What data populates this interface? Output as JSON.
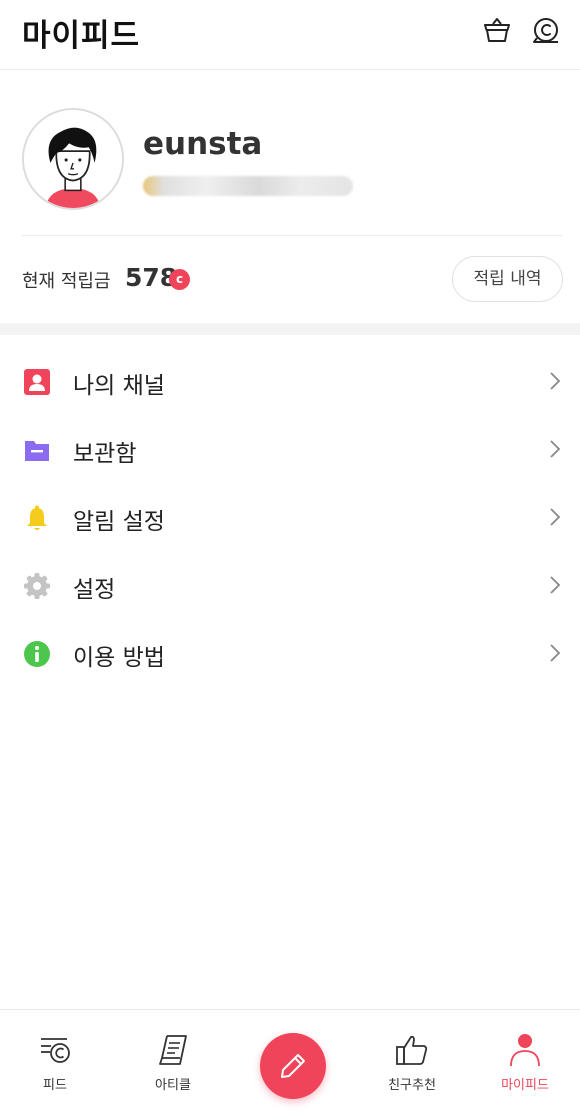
{
  "header": {
    "title": "마이피드",
    "icons": [
      "basket-icon",
      "coin-icon"
    ]
  },
  "profile": {
    "username": "eunsta",
    "avatar": "avatar-illustration"
  },
  "points": {
    "label": "현재 적립금",
    "value": "578",
    "coin_symbol": "c",
    "history_button": "적립 내역"
  },
  "menu": {
    "items": [
      {
        "label": "나의 채널",
        "icon": "person-icon",
        "color": "#f0445a"
      },
      {
        "label": "보관함",
        "icon": "folder-icon",
        "color": "#8b6cf0"
      },
      {
        "label": "알림 설정",
        "icon": "bell-icon",
        "color": "#f5cc1b"
      },
      {
        "label": "설정",
        "icon": "gear-icon",
        "color": "#c4c4c4"
      },
      {
        "label": "이용 방법",
        "icon": "info-icon",
        "color": "#4cc64c"
      }
    ]
  },
  "bottom_nav": {
    "items": [
      {
        "label": "피드",
        "icon": "feed-icon",
        "active": false
      },
      {
        "label": "아티클",
        "icon": "article-icon",
        "active": false
      },
      {
        "label": "친구추천",
        "icon": "thumbs-up-icon",
        "active": false
      },
      {
        "label": "마이피드",
        "icon": "profile-icon",
        "active": true
      }
    ],
    "compose_icon": "pencil-icon"
  },
  "colors": {
    "accent": "#f0445a",
    "text": "#222222",
    "divider": "#ececec"
  }
}
